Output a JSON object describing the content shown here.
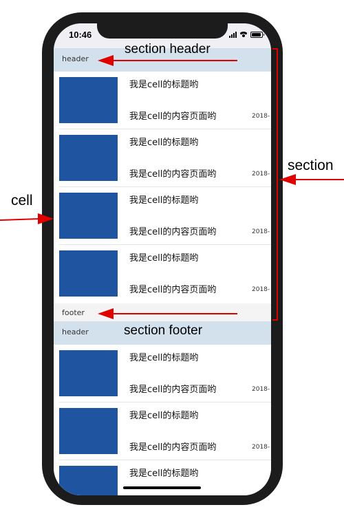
{
  "status_bar": {
    "time": "10:46"
  },
  "sections": [
    {
      "header": "header",
      "footer": "footer",
      "cells": [
        {
          "title": "我是cell的标题哟",
          "content": "我是cell的内容页面哟",
          "date": "2018-"
        },
        {
          "title": "我是cell的标题哟",
          "content": "我是cell的内容页面哟",
          "date": "2018-"
        },
        {
          "title": "我是cell的标题哟",
          "content": "我是cell的内容页面哟",
          "date": "2018-"
        },
        {
          "title": "我是cell的标题哟",
          "content": "我是cell的内容页面哟",
          "date": "2018-"
        }
      ]
    },
    {
      "header": "header",
      "cells": [
        {
          "title": "我是cell的标题哟",
          "content": "我是cell的内容页面哟",
          "date": "2018-"
        },
        {
          "title": "我是cell的标题哟",
          "content": "我是cell的内容页面哟",
          "date": "2018-"
        },
        {
          "title": "我是cell的标题哟"
        }
      ]
    }
  ],
  "annotations": {
    "section_header": "section header",
    "section_footer": "section footer",
    "section": "section",
    "cell": "cell"
  },
  "colors": {
    "thumbnail": "#1f55a0",
    "header_bg": "#d3e1ec",
    "footer_bg": "#f4f4f4",
    "arrow": "#e00000",
    "device_frame": "#1c1c1c"
  }
}
